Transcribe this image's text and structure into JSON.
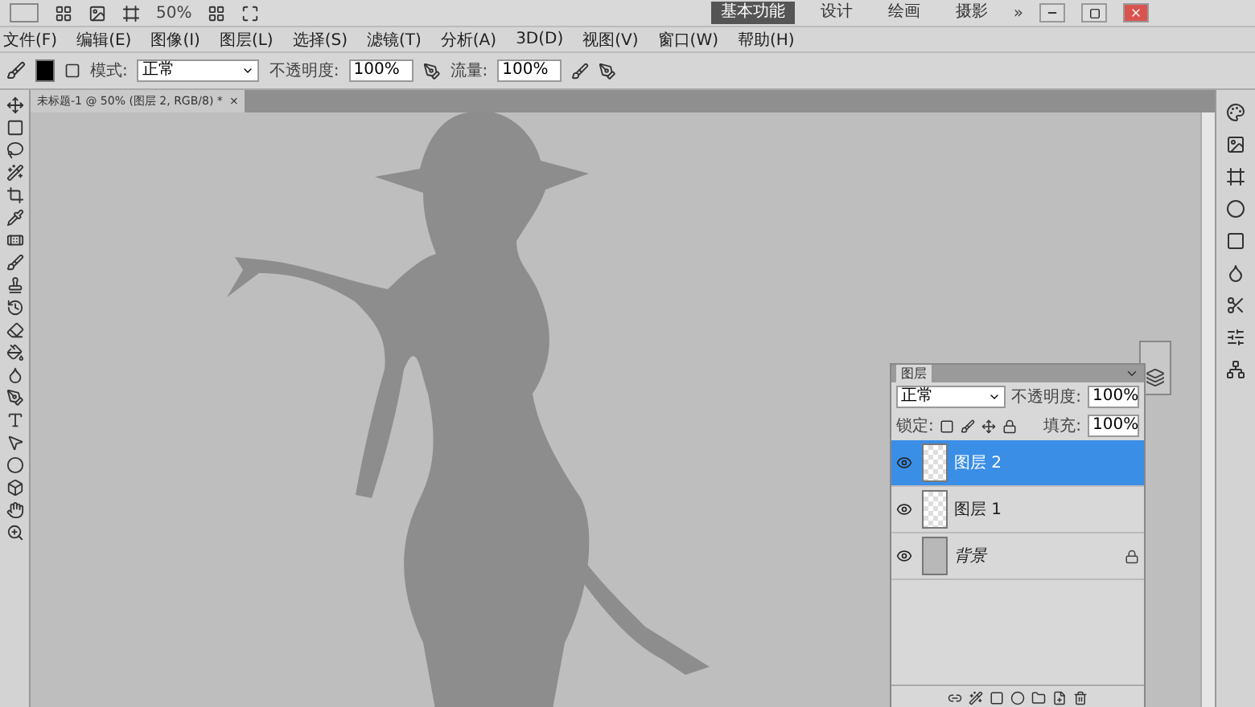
{
  "app_bar": {
    "zoom": "50%",
    "workspaces": [
      {
        "label": "基本功能",
        "selected": true
      },
      {
        "label": "设计",
        "selected": false
      },
      {
        "label": "绘画",
        "selected": false
      },
      {
        "label": "摄影",
        "selected": false
      }
    ],
    "more": "»"
  },
  "menu": [
    "文件(F)",
    "编辑(E)",
    "图像(I)",
    "图层(L)",
    "选择(S)",
    "滤镜(T)",
    "分析(A)",
    "3D(D)",
    "视图(V)",
    "窗口(W)",
    "帮助(H)"
  ],
  "options": {
    "mode_label": "模式:",
    "mode": "正常",
    "opacity_label": "不透明度:",
    "opacity": "100%",
    "flow_label": "流量:",
    "flow": "100%"
  },
  "document_tab": {
    "title": "未标题-1 @ 50% (图层 2, RGB/8) *",
    "close": "×"
  },
  "layers_panel": {
    "title": "图层",
    "blend_mode": "正常",
    "opacity_label": "不透明度:",
    "opacity": "100%",
    "lock_label": "锁定:",
    "fill_label": "填充:",
    "fill": "100%",
    "layers": [
      {
        "name": "图层 2",
        "selected": true,
        "visible": true,
        "locked": false,
        "kind": "transparent"
      },
      {
        "name": "图层 1",
        "selected": false,
        "visible": true,
        "locked": false,
        "kind": "transparent"
      },
      {
        "name": "背景",
        "selected": false,
        "visible": true,
        "locked": true,
        "kind": "background"
      }
    ]
  }
}
